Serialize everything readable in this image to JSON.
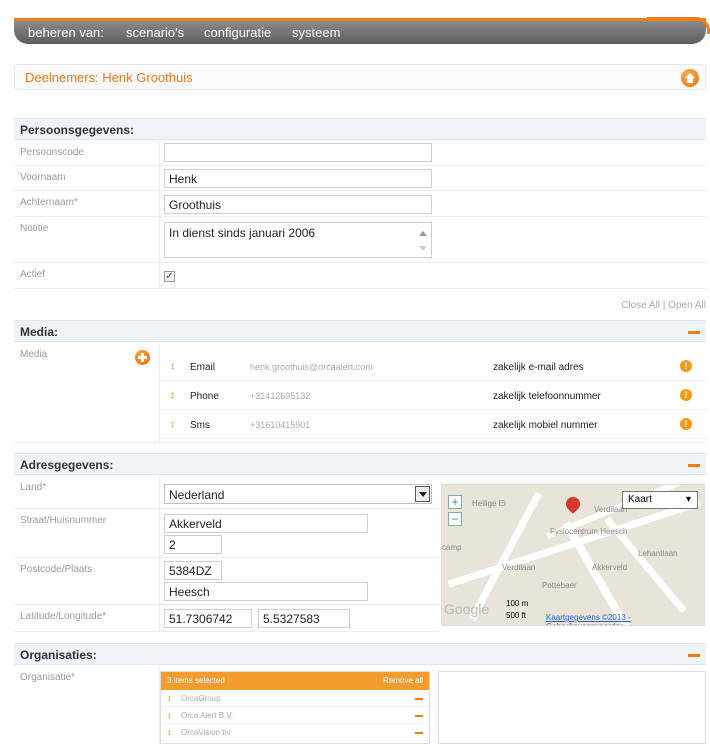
{
  "nav": {
    "items": [
      "beheren van:",
      "scenario's",
      "configuratie",
      "systeem"
    ]
  },
  "header": {
    "title": "Deelnemers: Henk Groothuis"
  },
  "persoon": {
    "section_title": "Persoonsgegevens:",
    "fields": [
      {
        "label": "Persoonscode",
        "value": ""
      },
      {
        "label": "Voornaam",
        "value": "Henk"
      },
      {
        "label": "Achternaam*",
        "value": "Groothuis"
      },
      {
        "label": "Notitie",
        "value": "In dienst sinds januari 2006"
      },
      {
        "label": "Actief",
        "value": "checked"
      }
    ]
  },
  "close_all": "Close All | Open All",
  "media": {
    "section_title": "Media:",
    "label": "Media",
    "items": [
      {
        "type": "Email",
        "value": "henk.groothuis@orcaalert.com",
        "description": "zakelijk e-mail adres"
      },
      {
        "type": "Phone",
        "value": "+31412695132",
        "description": "zakelijk telefoonnummer"
      },
      {
        "type": "Sms",
        "value": "+31610415901",
        "description": "zakelijk mobiel nummer"
      }
    ]
  },
  "adres": {
    "section_title": "Adresgegevens:",
    "land_label": "Land*",
    "land_value": "Nederland",
    "straat_label": "Straat/Huisnummer",
    "straat_value": "Akkerveld",
    "huisnummer_value": "2",
    "postcode_label": "Postcode/Plaats",
    "postcode_value": "5384DZ",
    "plaats_value": "Heesch",
    "latlong_label": "Latitude/Longitude*",
    "lat_value": "51.7306742",
    "long_value": "5.5327583"
  },
  "map": {
    "type_option": "Kaart",
    "labels": [
      "Heilige Ei",
      "Verdilaan",
      "Fysiocentrum Heesch",
      "Verdilaan",
      "Pottebaer",
      "Akkerveld",
      "Lehantlaan",
      "camp"
    ],
    "scale_m": "100 m",
    "scale_ft": "500 ft",
    "link_text": "Kaartgegevens ©2013 - Gebruiksvoorwaarden",
    "brand": "Google"
  },
  "org": {
    "section_title": "Organisaties:",
    "label": "Organisatie*",
    "selected_text": "3 items selected",
    "remove_all": "Remove all",
    "items": [
      "OrcaGroup",
      "Orca Alert B.V.",
      "OrcaVision bv"
    ]
  }
}
